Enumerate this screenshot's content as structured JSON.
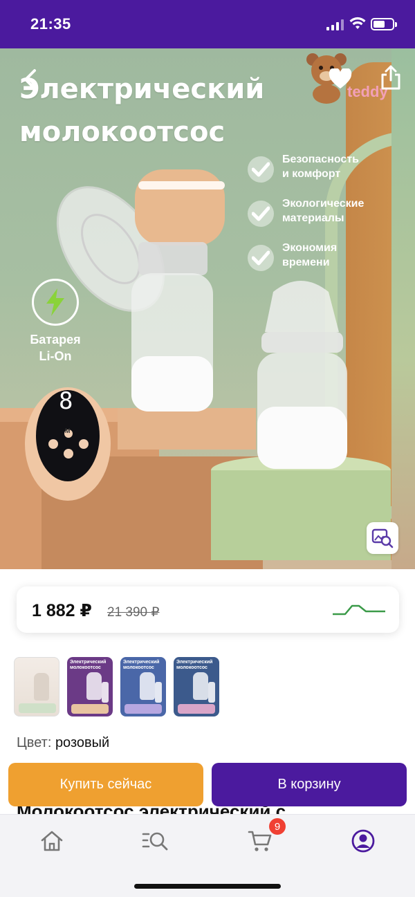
{
  "status_bar": {
    "time": "21:35",
    "battery_level": 0.6
  },
  "hero": {
    "title_line1": "Электрический",
    "title_line2": "молокоотсос",
    "brand": "teddy",
    "features": [
      {
        "line1": "Безопасность",
        "line2": "и комфорт"
      },
      {
        "line1": "Экологические",
        "line2": "материалы"
      },
      {
        "line1": "Экономия",
        "line2": "времени"
      }
    ],
    "battery_badge": {
      "line1": "Батарея",
      "line2": "Li-On"
    },
    "device_display": "8",
    "device_keys": {
      "mode": "M"
    }
  },
  "price": {
    "current": "1 882 ₽",
    "old": "21 390 ₽"
  },
  "thumbnails": [
    {
      "title": "",
      "bg": "#ede5dd",
      "ped": "#cfe0c8"
    },
    {
      "title": "Электрический молокоотсос",
      "bg": "#6b3a86",
      "ped": "#e8c4a0"
    },
    {
      "title": "Электрический молокоотсос",
      "bg": "#4a67a8",
      "ped": "#b7a7e0"
    },
    {
      "title": "Электрический молокоотсос",
      "bg": "#3c5a8c",
      "ped": "#d9a5c8"
    }
  ],
  "color": {
    "label": "Цвет:",
    "value": "розовый"
  },
  "actions": {
    "buy_now": "Купить сейчас",
    "add_to_cart": "В корзину"
  },
  "product_title_partial": "Молокоотсос электрический с",
  "tabbar": {
    "cart_count": "9"
  },
  "colors": {
    "brand": "#4b1a9e",
    "buy": "#efa030",
    "badge": "#f04033",
    "graph": "#3a9a48"
  }
}
